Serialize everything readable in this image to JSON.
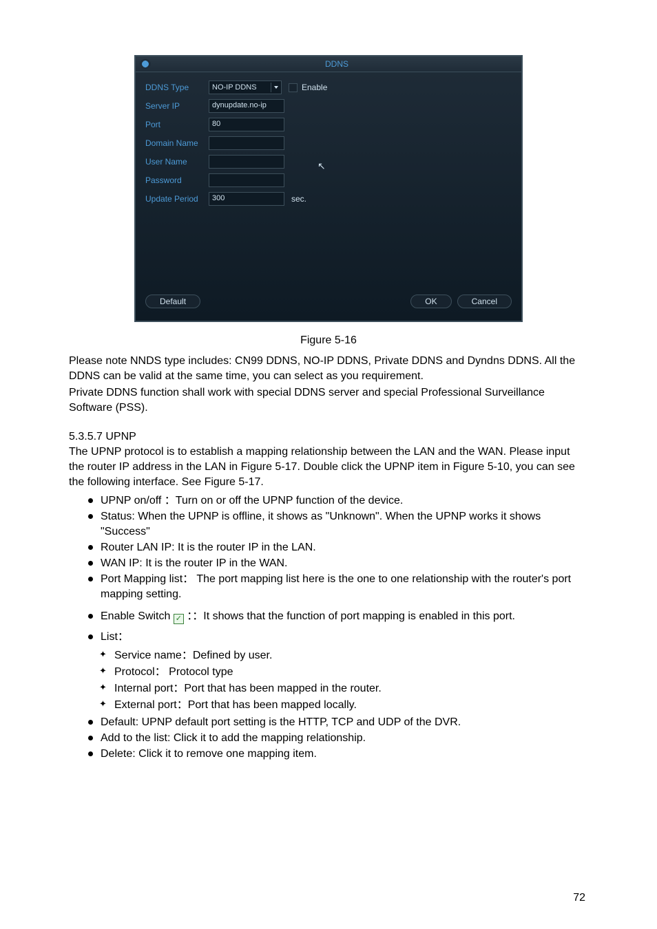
{
  "ddns_dialog": {
    "title": "DDNS",
    "rows": {
      "type_lbl": "DDNS Type",
      "type_val": "NO-IP DDNS",
      "enable_lbl": "Enable",
      "server_ip_lbl": "Server IP",
      "server_ip_val": "dynupdate.no-ip",
      "port_lbl": "Port",
      "port_val": "80",
      "domain_lbl": "Domain Name",
      "domain_val": "",
      "user_lbl": "User Name",
      "user_val": "",
      "pwd_lbl": "Password",
      "pwd_val": "",
      "period_lbl": "Update Period",
      "period_val": "300",
      "period_sec": "sec."
    },
    "buttons": {
      "default": "Default",
      "ok": "OK",
      "cancel": "Cancel"
    }
  },
  "figure_caption": "Figure 5-16",
  "ddns_note_1": "Please note NNDS type includes: CN99 DDNS, NO-IP DDNS, Private DDNS and Dyndns DDNS. All the DDNS can be valid at the same time, you can select as you requirement.",
  "ddns_note_2": "Private DDNS function shall work with special DDNS server and special Professional Surveillance Software (PSS).",
  "upnp": {
    "heading": "5.3.5.7  UPNP",
    "intro_1": "The UPNP protocol is to establish a mapping relationship between the LAN and the WAN. Please input the router IP address in the LAN in Figure 5-17. Double click the UPNP item in Figure 5-10, you can see the following interface. See Figure 5-17.",
    "bullets": [
      "UPNP  on/off ：Turn on or off the UPNP function of the device.",
      "Status:  When the UPNP is offline, it shows as \"Unknown\". When the UPNP works it shows \"Success\"",
      "Router LAN IP: It is the router IP in the LAN.",
      "WAN IP: It is the router IP in the WAN.",
      "Port Mapping list： The port mapping list here is the one to one relationship with the router's port mapping setting."
    ],
    "bullet_enable_switch_pre": "Enable Switch ",
    "bullet_enable_switch_post": " ：：It shows that the function of port mapping is enabled in this port.",
    "bullet_list_label": "List：",
    "diamonds": [
      "Service name：Defined by user.",
      "Protocol： Protocol type",
      "Internal port：Port that has been mapped in the router.",
      "External port：Port that has been mapped locally."
    ],
    "bullets_tail": [
      "Default: UPNP default port setting is the HTTP, TCP and UDP of the DVR.",
      "Add to the list: Click it to add the mapping relationship.",
      "Delete: Click it to remove one mapping item."
    ]
  },
  "page_number": "72"
}
